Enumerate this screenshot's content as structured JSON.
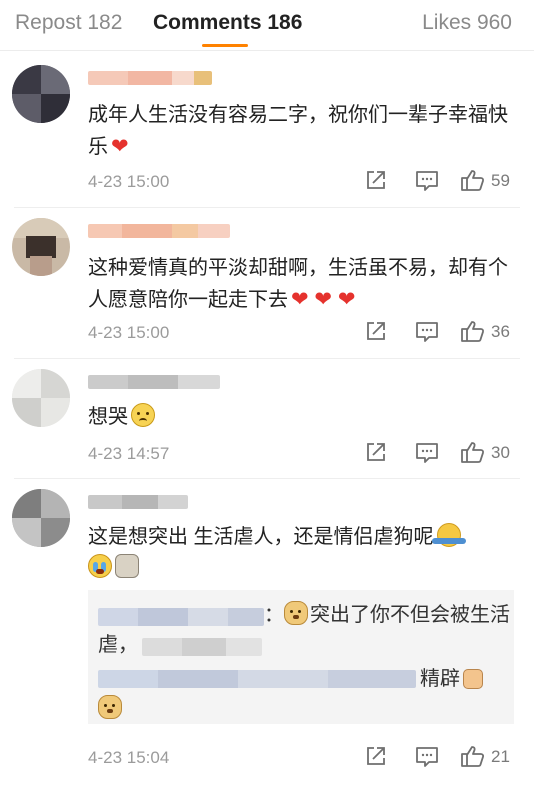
{
  "tabs": {
    "repost": "Repost 182",
    "comments": "Comments 186",
    "likes": "Likes 960"
  },
  "comments": [
    {
      "text": "成年人生活没有容易二字，祝你们一辈子幸福快乐",
      "hearts": "❤",
      "time": "4-23 15:00",
      "likes": "59"
    },
    {
      "text": "这种爱情真的平淡却甜啊，生活虽不易，却有个人愿意陪你一起走下去",
      "hearts": "❤ ❤ ❤",
      "time": "4-23 15:00",
      "likes": "36"
    },
    {
      "text": "想哭",
      "time": "4-23 14:57",
      "likes": "30"
    },
    {
      "text": "这是想突出 生活虐人，还是情侣虐狗呢",
      "time": "4-23 15:04",
      "likes": "21",
      "reply_1_a": "：",
      "reply_1_b": "突出了你不但会被生活",
      "reply_1_c": "虐，",
      "reply_2": "精辟"
    }
  ],
  "icons": {
    "share": "share-icon",
    "comment": "comment-icon",
    "like": "thumbs-up-icon"
  },
  "colors": {
    "accent": "#ff8200",
    "heart": "#e5322d",
    "muted": "#9b9b9b"
  }
}
